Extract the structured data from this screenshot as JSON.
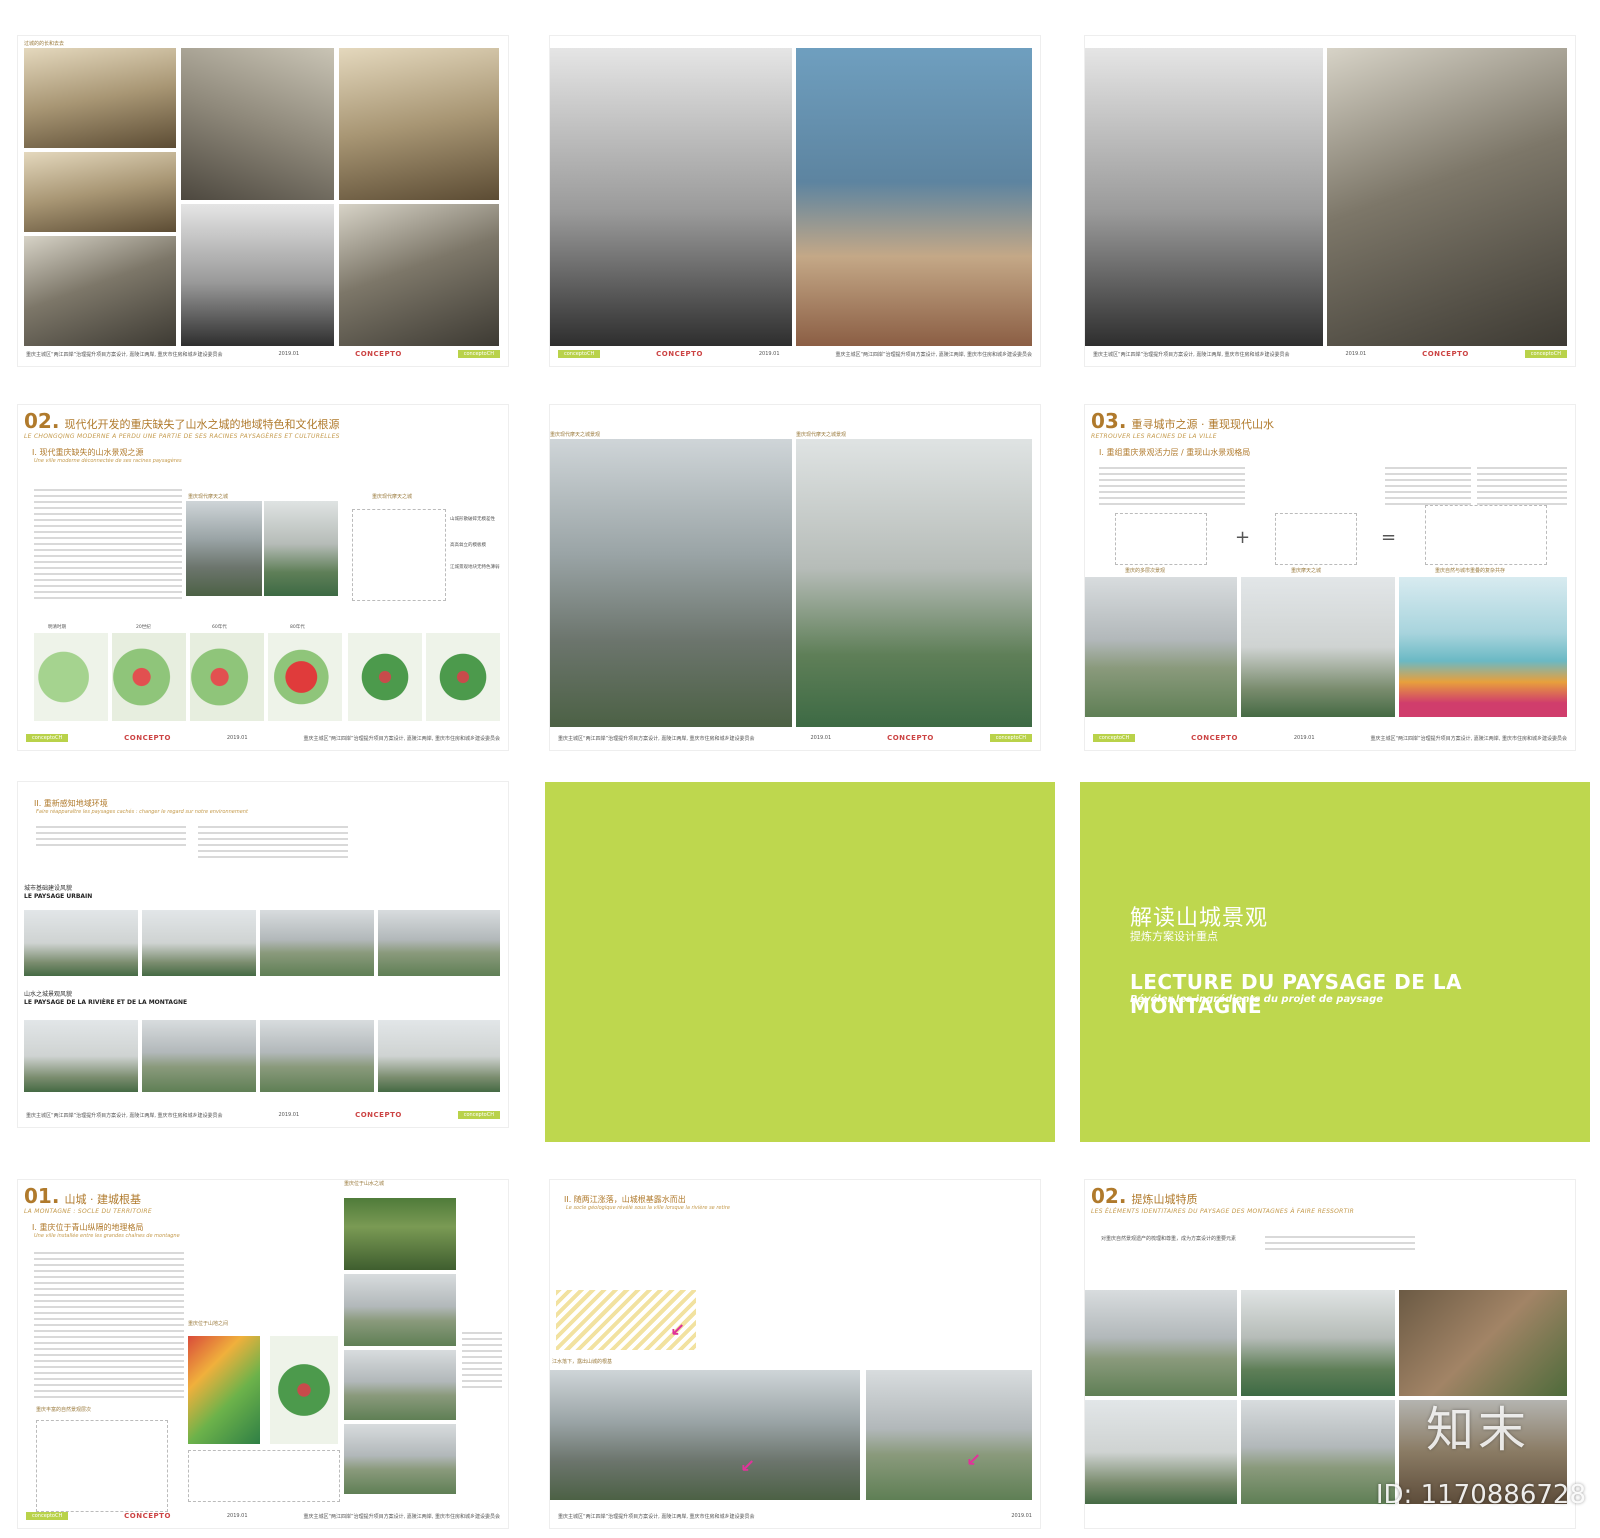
{
  "watermark": {
    "logo": "知末",
    "id": "ID: 1170886728"
  },
  "page1": {
    "caption": "过城的的长和去去",
    "footer_center": "重庆主城区“两江四岸”治理提升项目方案设计, 嘉陵江两岸, 重庆市住房和城乡建设委员会",
    "footer_date": "2019.01",
    "footer_logo": "CONCEPTO",
    "footer_tag": "conceptoCH"
  },
  "page3": {
    "footer_logo": "CONCEPTO"
  },
  "page4": {
    "num": "02.",
    "title": "现代化开发的重庆缺失了山水之城的地域特色和文化根源",
    "subtitle": "LE CHONGQING MODERNE A PERDU UNE PARTIE DE SES RACINES PAYSAGÈRES ET CULTURELLES",
    "section": "I. 现代重庆缺失的山水景观之源",
    "section_sub": "Une ville moderne déconnectée de ses racines paysagères",
    "cap1": "重庆现代摩天之城",
    "cap2": "重庆现代摩天之城",
    "map_labels": [
      "明清时期",
      "20世纪",
      "60年代",
      "80年代"
    ],
    "legend": [
      "山城形散破碎无模差性",
      "高高耸立的模板模",
      "江城景观地块无特色薄弱"
    ]
  },
  "page5": {
    "cap1": "重庆现代摩天之城景观",
    "cap2": "重庆现代摩天之城景观"
  },
  "page6": {
    "num": "03.",
    "title": "重寻城市之源 · 重现现代山水",
    "subtitle": "RETROUVER LES RACINES DE LA VILLE",
    "section": "I. 重组重庆景观活力层 / 重现山水景观格局",
    "plus": "+",
    "eq": "=",
    "sketch_caps": [
      "重庆的多层次景观",
      "重庆摩天之城",
      "重庆自然与城市重叠的复杂共存"
    ]
  },
  "page7": {
    "section": "II. 重新感知地域环境",
    "section_sub": "Faire réapparaître les paysages cachés : changer le regard sur notre environnement",
    "block1_cn": "城市基础建设风貌",
    "block1_fr": "LE PAYSAGE URBAIN",
    "block2_cn": "山水之城景观风貌",
    "block2_fr": "LE PAYSAGE DE LA RIVIÈRE ET DE LA MONTAGNE"
  },
  "page9": {
    "cn_title": "解读山城景观",
    "cn_sub": "提炼方案设计重点",
    "fr_title": "LECTURE DU PAYSAGE DE LA MONTAGNE",
    "fr_sub": "Révéler les ingrédients du projet de paysage"
  },
  "page10": {
    "num": "01.",
    "title": "山城 · 建城根基",
    "subtitle": "LA MONTAGNE : SOCLE DU TERRITOIRE",
    "section": "I. 重庆位于青山纵隔的地理格局",
    "section_sub": "Une ville installée entre les grandes chaînes de montagne",
    "cap1": "重庆位于山水之城",
    "cap2": "重庆位于山地之间",
    "cap3": "重庆丰富的自然景观层次"
  },
  "page11": {
    "section": "II. 随两江涨落，山城根基露水而出",
    "section_sub": "Le socle géologique révélé sous la ville lorsque la rivière se retire",
    "cap": "江水落下，露出山城的根基"
  },
  "page12": {
    "num": "02.",
    "title": "提炼山城特质",
    "subtitle": "LES ÉLÉMENTS IDENTITAIRES DU PAYSAGE DES MONTAGNES À FAIRE RESSORTIR",
    "intro": "对重庆自然景观遗产的梳理和尊重，成为方案设计的重要元素"
  }
}
